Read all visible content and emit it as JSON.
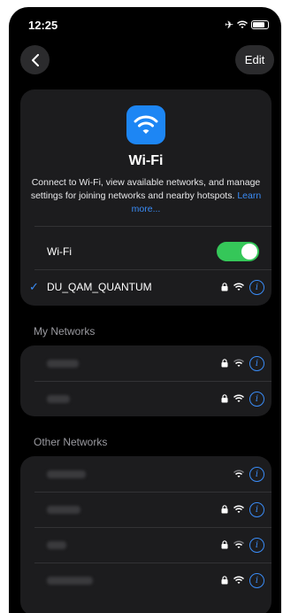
{
  "status_bar": {
    "time": "12:25"
  },
  "nav": {
    "edit_label": "Edit"
  },
  "hero": {
    "title": "Wi-Fi",
    "description": "Connect to Wi-Fi, view available networks, and manage settings for joining networks and nearby hotspots.",
    "learn_more": "Learn more..."
  },
  "wifi_toggle": {
    "label": "Wi-Fi",
    "enabled": true
  },
  "connected_network": {
    "name": "DU_QAM_QUANTUM",
    "secured": true
  },
  "sections": {
    "my_networks": "My Networks",
    "other_networks": "Other Networks"
  },
  "colors": {
    "accent": "#3a8cf7",
    "toggle_on": "#35c759",
    "card_bg": "#1c1c1e",
    "screen_bg": "#000000"
  }
}
